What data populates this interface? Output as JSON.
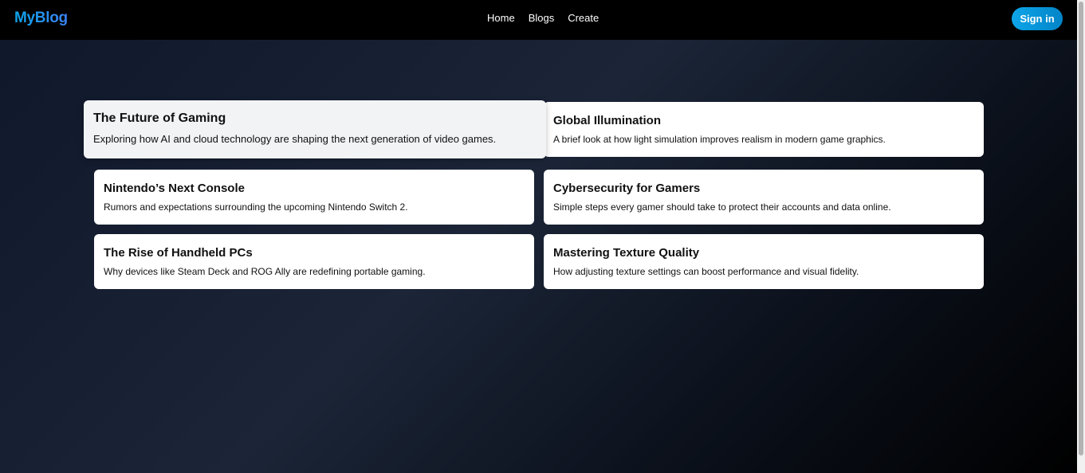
{
  "navbar": {
    "logo": "MyBlog",
    "links": [
      "Home",
      "Blogs",
      "Create"
    ],
    "signin_label": "Sign in"
  },
  "posts": [
    {
      "title": "The Future of Gaming",
      "description": "Exploring how AI and cloud technology are shaping the next generation of video games."
    },
    {
      "title": "Global Illumination",
      "description": "A brief look at how light simulation improves realism in modern game graphics."
    },
    {
      "title": "Nintendo’s Next Console",
      "description": "Rumors and expectations surrounding the upcoming Nintendo Switch 2."
    },
    {
      "title": "Cybersecurity for Gamers",
      "description": "Simple steps every gamer should take to protect their accounts and data online."
    },
    {
      "title": "The Rise of Handheld PCs",
      "description": "Why devices like Steam Deck and ROG Ally are redefining portable gaming."
    },
    {
      "title": "Mastering Texture Quality",
      "description": "How adjusting texture settings can boost performance and visual fidelity."
    }
  ],
  "colors": {
    "accent": "#0ea5e9",
    "navbar_bg": "#000000",
    "card_bg": "#ffffff",
    "card_hover_bg": "#f2f3f5"
  }
}
